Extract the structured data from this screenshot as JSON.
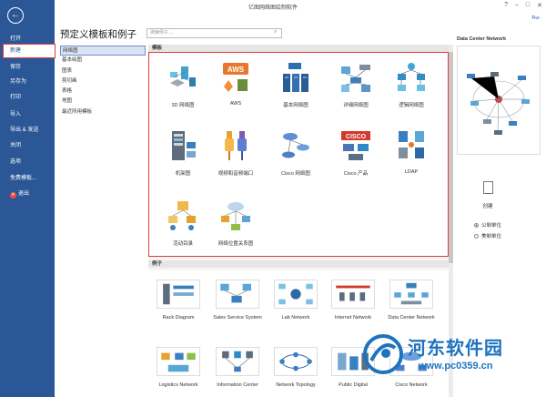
{
  "window": {
    "title": "亿图网络图绘制软件",
    "user": "Rui ·"
  },
  "sidebar": {
    "items": [
      {
        "label": "打开"
      },
      {
        "label": "新建"
      },
      {
        "label": "保存"
      },
      {
        "label": "另存为"
      },
      {
        "label": "打印"
      },
      {
        "label": "导入"
      },
      {
        "label": "导出 & 发送"
      },
      {
        "label": "关闭"
      },
      {
        "label": "选项"
      },
      {
        "label": "免费模板..."
      },
      {
        "label": "退出"
      }
    ]
  },
  "panel": {
    "title": "预定义模板和例子",
    "search_placeholder": "搜索例子 ..."
  },
  "categories": [
    {
      "label": "网络图"
    },
    {
      "label": "基本绘图"
    },
    {
      "label": "图表"
    },
    {
      "label": "剪切画"
    },
    {
      "label": "表格"
    },
    {
      "label": "地图"
    },
    {
      "label": "最近所用模板"
    }
  ],
  "templates": {
    "header": "模板",
    "items": [
      {
        "label": "3D 网络图",
        "icon": "3d-network-icon"
      },
      {
        "label": "AWS",
        "icon": "aws-icon"
      },
      {
        "label": "基本网络图",
        "icon": "basic-network-icon"
      },
      {
        "label": "详细网络图",
        "icon": "detailed-network-icon"
      },
      {
        "label": "逻辑网络图",
        "icon": "logical-network-icon"
      },
      {
        "label": "机架图",
        "icon": "rack-icon"
      },
      {
        "label": "视频和音频端口",
        "icon": "av-ports-icon"
      },
      {
        "label": "Cisco 网络图",
        "icon": "cisco-network-icon"
      },
      {
        "label": "Cisco 产品",
        "icon": "cisco-products-icon"
      },
      {
        "label": "LDAP",
        "icon": "ldap-icon"
      },
      {
        "label": "活动目录",
        "icon": "active-directory-icon"
      },
      {
        "label": "网络位置关系图",
        "icon": "network-location-icon"
      }
    ]
  },
  "examples": {
    "header": "例子",
    "items": [
      {
        "label": "Rack Diagram"
      },
      {
        "label": "Sales Service System"
      },
      {
        "label": "Lab Network"
      },
      {
        "label": "Internet Network"
      },
      {
        "label": "Data Center Network"
      },
      {
        "label": "Logistics Network"
      },
      {
        "label": "Information Center"
      },
      {
        "label": "Network Topology"
      },
      {
        "label": "Public Digital"
      },
      {
        "label": "Cisco Network"
      }
    ]
  },
  "preview": {
    "title": "Data Center Network",
    "create_label": "创建",
    "units": [
      {
        "label": "公制单位",
        "selected": true
      },
      {
        "label": "美制单位",
        "selected": false
      }
    ]
  },
  "watermark": {
    "title": "河东软件园",
    "url": "www.pc0359.cn"
  },
  "colors": {
    "sidebar": "#2b5797",
    "highlight_border": "#e23a3a",
    "accent": "#1e73be"
  }
}
